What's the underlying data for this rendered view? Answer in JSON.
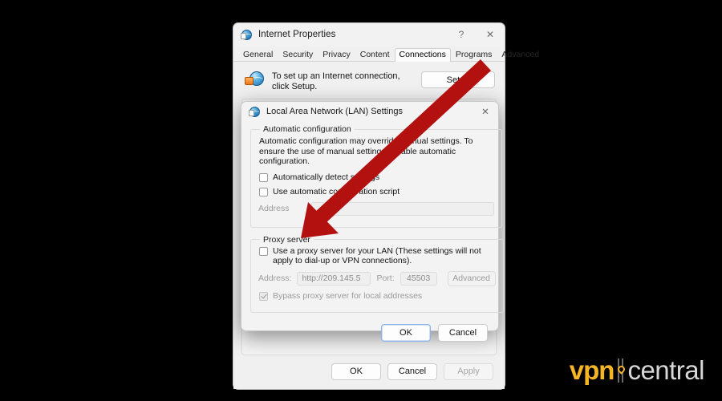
{
  "window": {
    "title": "Internet Properties",
    "icon": "internet-properties-icon",
    "help_label": "?",
    "close_label": "✕",
    "tabs": [
      {
        "label": "General",
        "active": false
      },
      {
        "label": "Security",
        "active": false
      },
      {
        "label": "Privacy",
        "active": false
      },
      {
        "label": "Content",
        "active": false
      },
      {
        "label": "Connections",
        "active": true
      },
      {
        "label": "Programs",
        "active": false
      },
      {
        "label": "Advanced",
        "active": false
      }
    ],
    "connections": {
      "setup_icon": "globe-plug-icon",
      "setup_text": "To set up an Internet connection, click Setup.",
      "setup_button": "Setup"
    },
    "footer_buttons": [
      {
        "label": "OK",
        "disabled": false
      },
      {
        "label": "Cancel",
        "disabled": false
      },
      {
        "label": "Apply",
        "disabled": true
      }
    ]
  },
  "lan_dialog": {
    "title": "Local Area Network (LAN) Settings",
    "icon": "lan-settings-icon",
    "close_label": "✕",
    "automatic_configuration": {
      "legend": "Automatic configuration",
      "description": "Automatic configuration may override manual settings.  To ensure the use of manual settings, disable automatic configuration.",
      "detect_settings": {
        "label": "Automatically detect settings",
        "checked": false
      },
      "use_script": {
        "label": "Use automatic configuration script",
        "checked": false
      },
      "address_label": "Address",
      "address_value": ""
    },
    "proxy_server": {
      "legend": "Proxy server",
      "use_proxy": {
        "label": "Use a proxy server for your LAN (These settings will not apply to dial-up or VPN connections).",
        "checked": false
      },
      "address_label": "Address:",
      "address_value": "http://209.145.5",
      "port_label": "Port:",
      "port_value": "45503",
      "advanced_button": "Advanced",
      "bypass": {
        "label": "Bypass proxy server for local addresses",
        "checked": true
      }
    },
    "footer_buttons": [
      {
        "label": "OK",
        "default": true
      },
      {
        "label": "Cancel",
        "default": false
      }
    ]
  },
  "annotation": {
    "arrow": "red-arrow-pointing-to-use-proxy-checkbox",
    "color": "#b31010"
  },
  "logo": {
    "primary": "vpn",
    "secondary": "central",
    "primary_color": "#f5b525",
    "secondary_color": "#d7d7d7"
  }
}
